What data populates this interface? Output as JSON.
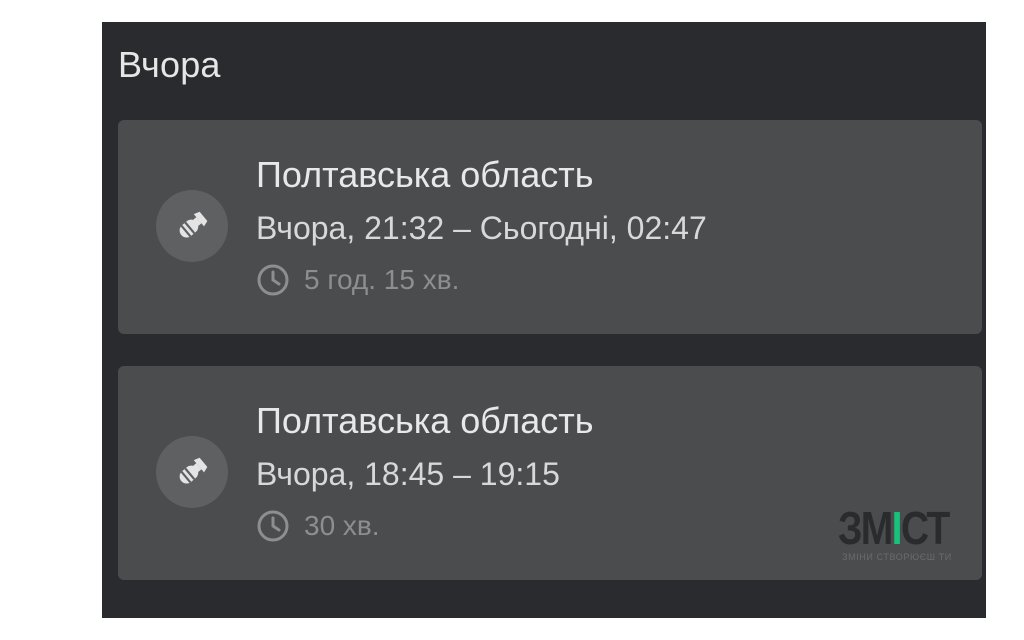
{
  "section": {
    "title": "Вчора"
  },
  "alerts": [
    {
      "region": "Полтавська область",
      "time_range": "Вчора, 21:32 – Сьогодні, 02:47",
      "duration": "5 год. 15 хв.",
      "icon": "bomb-icon"
    },
    {
      "region": "Полтавська область",
      "time_range": "Вчора, 18:45 – 19:15",
      "duration": "30 хв.",
      "icon": "bomb-icon"
    }
  ],
  "watermark": {
    "logo_left": "ЗМ",
    "logo_dot": "І",
    "logo_right": "СТ",
    "tagline": "ЗМІНИ СТВОРЮЄШ ТИ"
  },
  "colors": {
    "panel_bg": "#2a2b2e",
    "card_bg": "#4b4c4e",
    "icon_circle": "#5f6062",
    "accent_green": "#17c27a"
  }
}
